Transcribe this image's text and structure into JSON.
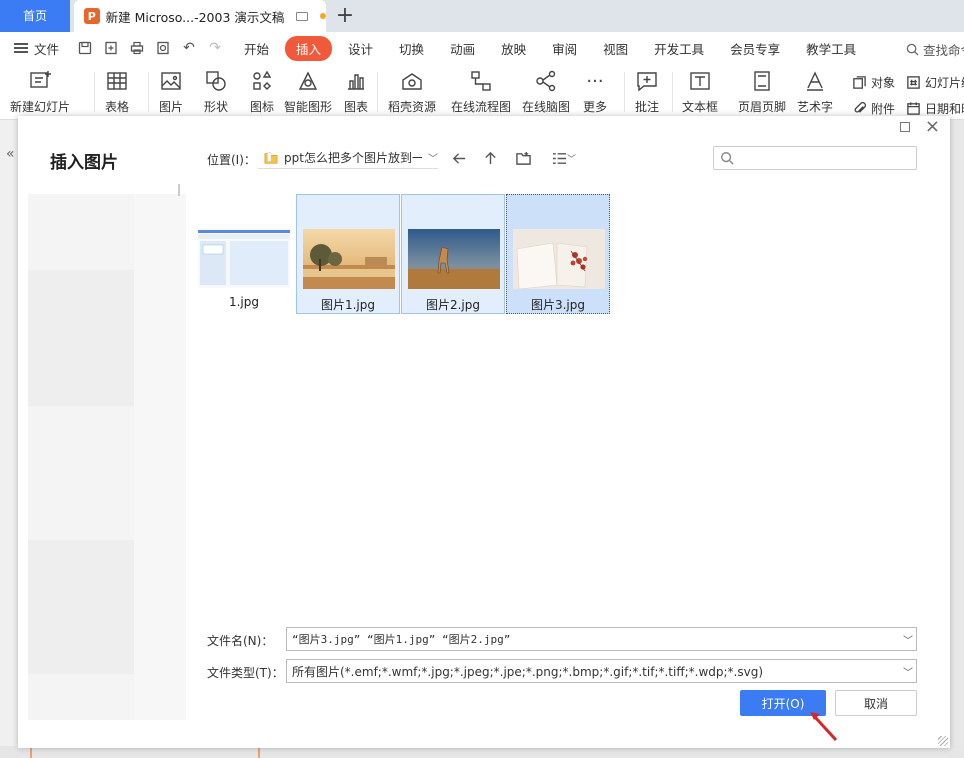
{
  "tabs": {
    "home": "首页",
    "doc_title": "新建 Microso...-2003 演示文稿",
    "doc_icon": "P"
  },
  "menubar": {
    "file": "文件",
    "tabs": [
      "开始",
      "插入",
      "设计",
      "切换",
      "动画",
      "放映",
      "审阅",
      "视图",
      "开发工具",
      "会员专享",
      "教学工具"
    ],
    "active_tab": "插入",
    "search": "查找命令"
  },
  "ribbon": {
    "items": [
      "新建幻灯片",
      "表格",
      "图片",
      "形状",
      "图标",
      "智能图形",
      "图表",
      "稻壳资源",
      "在线流程图",
      "在线脑图",
      "更多",
      "批注",
      "文本框",
      "页眉页脚",
      "艺术字"
    ],
    "small": [
      "对象",
      "幻灯片编号",
      "附件",
      "日期和时间"
    ]
  },
  "dialog": {
    "title": "插入图片",
    "location_label": "位置(I)：",
    "location_path": "ppt怎么把多个图片放到一",
    "files": [
      {
        "name": "1.jpg",
        "state": "normal"
      },
      {
        "name": "图片1.jpg",
        "state": "selected"
      },
      {
        "name": "图片2.jpg",
        "state": "selected"
      },
      {
        "name": "图片3.jpg",
        "state": "focused"
      }
    ],
    "filename_label": "文件名(N)：",
    "filename_value": "“图片3.jpg” “图片1.jpg” “图片2.jpg”",
    "filetype_label": "文件类型(T)：",
    "filetype_value": "所有图片(*.emf;*.wmf;*.jpg;*.jpeg;*.jpe;*.png;*.bmp;*.gif;*.tif;*.tiff;*.wdp;*.svg)",
    "open_button": "打开(O)",
    "cancel_button": "取消"
  },
  "colors": {
    "accent_blue": "#3b7cf4",
    "insert_tab": "#f05a3a",
    "selection_bg": "#e3eefc"
  }
}
